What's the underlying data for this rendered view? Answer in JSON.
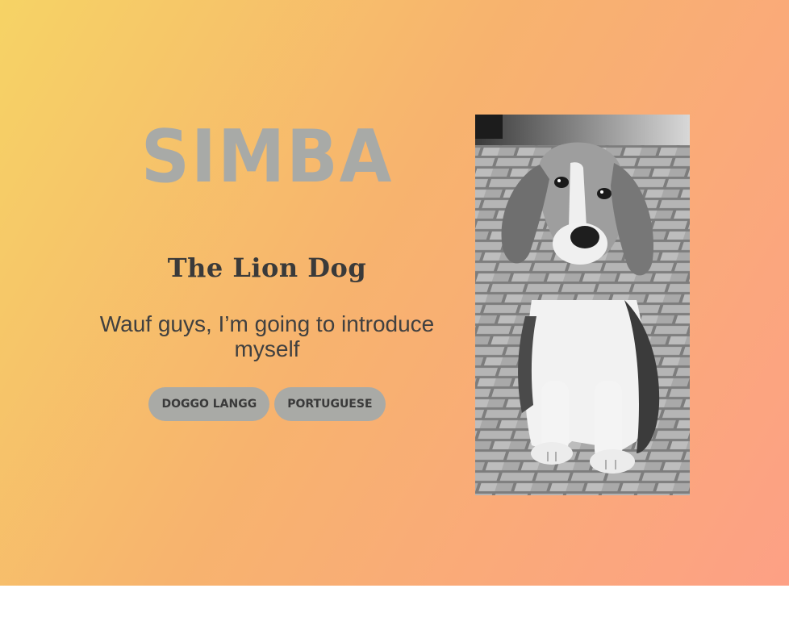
{
  "hero": {
    "title": "SIMBA",
    "subtitle": "The Lion Dog",
    "intro": "Wauf guys, I’m going to introduce myself",
    "tags": [
      {
        "label": "DOGGO LANGG"
      },
      {
        "label": "PORTUGUESE"
      }
    ]
  },
  "colors": {
    "gradient_start": "#f6d365",
    "gradient_end": "#fda085",
    "title_gray": "#a8aaa7",
    "tag_bg": "#a9aaa6",
    "text_dark": "#3a3a3a"
  },
  "photo": {
    "subject": "black-and-white photo of a beagle puppy sitting on brick pavement"
  }
}
